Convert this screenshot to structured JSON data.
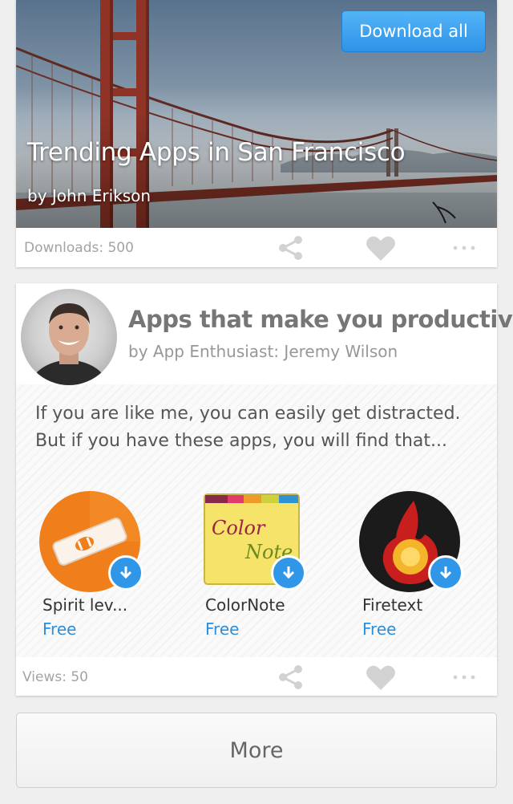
{
  "featured": {
    "title": "Trending Apps in San Francisco",
    "author": "by John Erikson",
    "download_all_label": "Download all",
    "footer": {
      "downloads_text": "Downloads: 500"
    }
  },
  "collection": {
    "title": "Apps that make you productive",
    "author": "by App Enthusiast: Jeremy Wilson",
    "description": "If you are like me, you can easily get distracted. But if you have these apps, you will find that...",
    "apps": [
      {
        "name": "Spirit lev...",
        "price": "Free",
        "icon": "spirit-level-icon"
      },
      {
        "name": "ColorNote",
        "price": "Free",
        "icon": "colornote-icon"
      },
      {
        "name": "Firetext",
        "price": "Free",
        "icon": "firetext-icon"
      }
    ],
    "footer": {
      "views_text": "Views: 50"
    }
  },
  "more_label": "More",
  "icons": {
    "share": "share-icon",
    "like": "heart-icon",
    "menu": "more-dots-icon",
    "download": "download-arrow-icon"
  },
  "colors": {
    "accent": "#2f96e8",
    "price": "#2a8fdc",
    "footer_text": "#a3a3a3",
    "icon_gray": "#d2d2d2"
  },
  "icon_letters": {
    "colornote_top": "Color",
    "colornote_bottom": "Note"
  }
}
